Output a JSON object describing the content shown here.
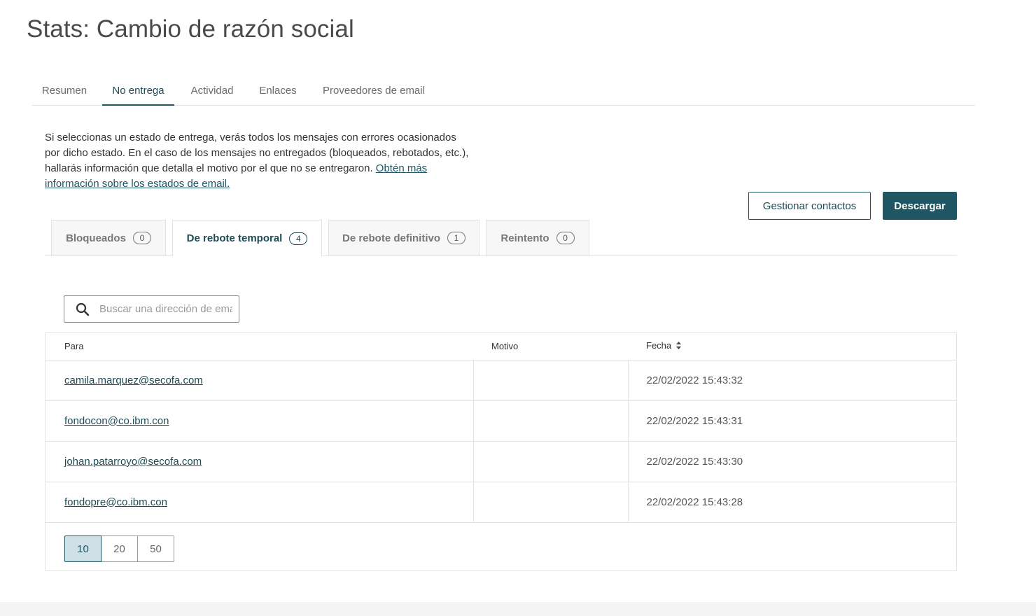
{
  "page": {
    "title": "Stats: Cambio de razón social"
  },
  "top_tabs": [
    {
      "label": "Resumen",
      "active": false
    },
    {
      "label": "No entrega",
      "active": true
    },
    {
      "label": "Actividad",
      "active": false
    },
    {
      "label": "Enlaces",
      "active": false
    },
    {
      "label": "Proveedores de email",
      "active": false
    }
  ],
  "description": {
    "text": "Si seleccionas un estado de entrega, verás todos los mensajes con errores ocasionados por dicho estado. En el caso de los mensajes no entregados (bloqueados, rebotados, etc.), hallarás información que detalla el motivo por el que no se entregaron.",
    "link_text": "Obtén más información sobre los estados de email."
  },
  "actions": {
    "manage_contacts_label": "Gestionar contactos",
    "download_label": "Descargar"
  },
  "status_tabs": [
    {
      "label": "Bloqueados",
      "count": "0",
      "active": false
    },
    {
      "label": "De rebote temporal",
      "count": "4",
      "active": true
    },
    {
      "label": "De rebote definitivo",
      "count": "1",
      "active": false
    },
    {
      "label": "Reintento",
      "count": "0",
      "active": false
    }
  ],
  "search": {
    "placeholder": "Buscar una dirección de email",
    "value": ""
  },
  "table": {
    "columns": [
      "Para",
      "Motivo",
      "Fecha"
    ],
    "rows": [
      {
        "to": "camila.marquez@secofa.com",
        "reason": "",
        "date": "22/02/2022 15:43:32"
      },
      {
        "to": "fondocon@co.ibm.con",
        "reason": "",
        "date": "22/02/2022 15:43:31"
      },
      {
        "to": "johan.patarroyo@secofa.com",
        "reason": "",
        "date": "22/02/2022 15:43:30"
      },
      {
        "to": "fondopre@co.ibm.con",
        "reason": "",
        "date": "22/02/2022 15:43:28"
      }
    ]
  },
  "pagination": {
    "sizes": [
      "10",
      "20",
      "50"
    ],
    "selected": "10"
  },
  "colors": {
    "accent": "#1e5663",
    "accent_light": "#cfe0e6",
    "border": "#e3e3e3"
  }
}
